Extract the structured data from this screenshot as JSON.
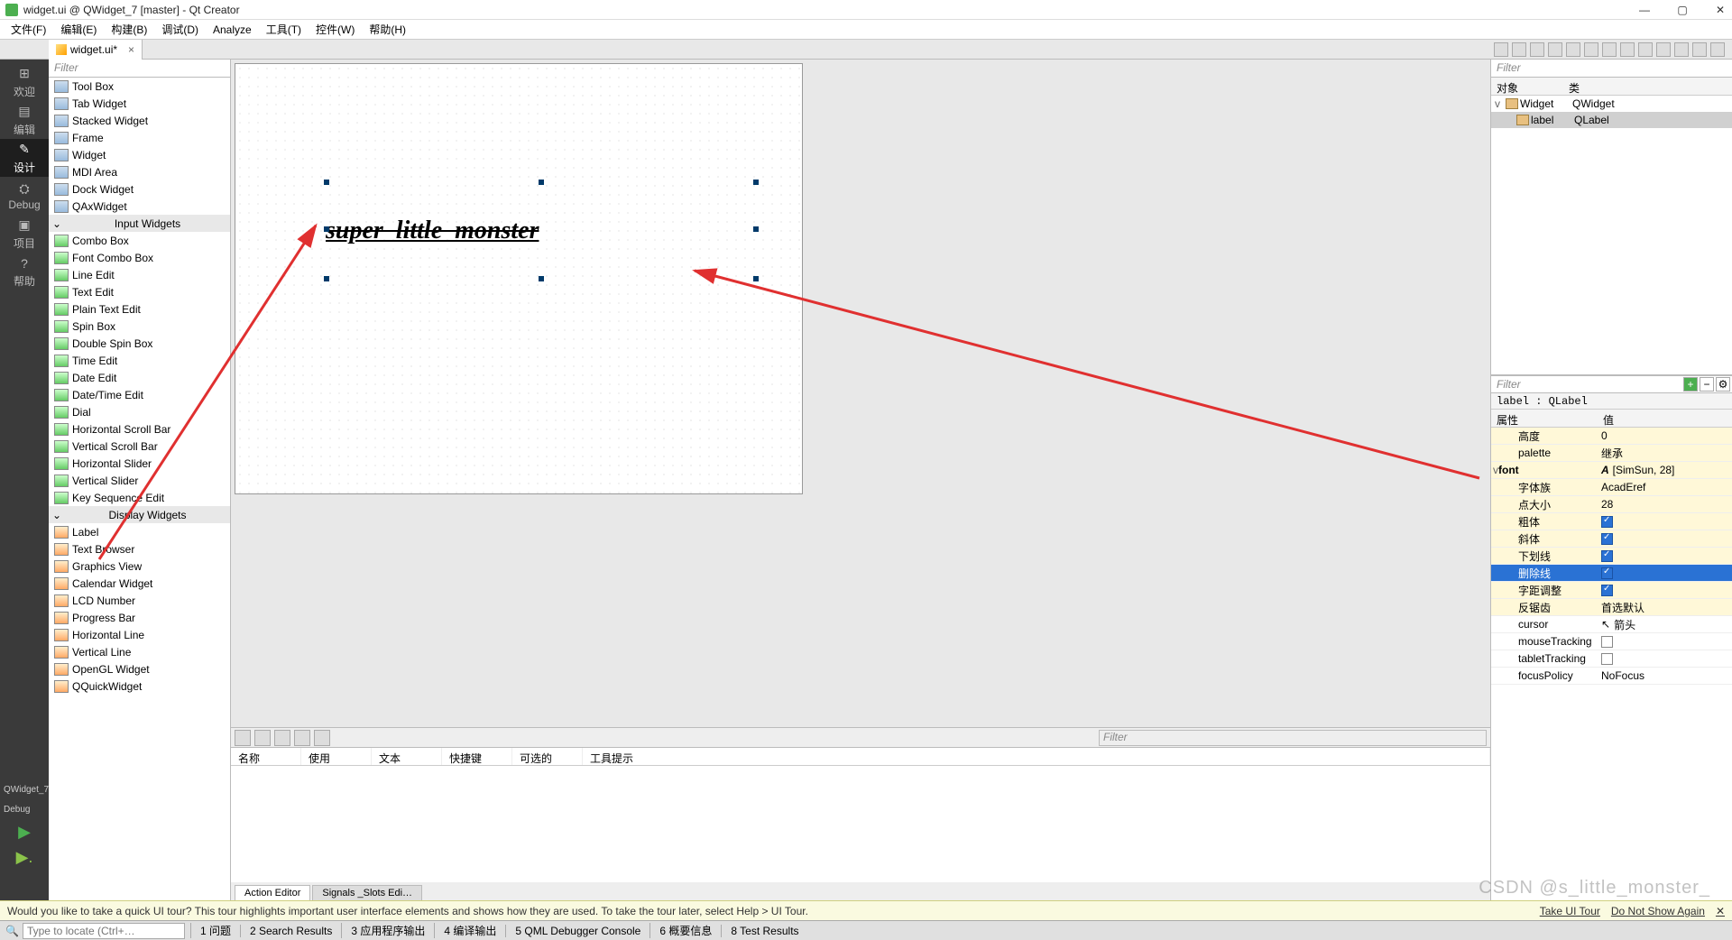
{
  "window": {
    "title": "widget.ui @ QWidget_7 [master] - Qt Creator",
    "min": "—",
    "max": "▢",
    "close": "✕"
  },
  "menu": [
    "文件(F)",
    "编辑(E)",
    "构建(B)",
    "调试(D)",
    "Analyze",
    "工具(T)",
    "控件(W)",
    "帮助(H)"
  ],
  "tab": {
    "filename": "widget.ui*",
    "close": "×"
  },
  "sidebar": [
    {
      "icon": "⊞",
      "label": "欢迎"
    },
    {
      "icon": "▤",
      "label": "编辑"
    },
    {
      "icon": "✎",
      "label": "设计",
      "active": true
    },
    {
      "icon": "⛭",
      "label": "Debug"
    },
    {
      "icon": "▣",
      "label": "项目"
    },
    {
      "icon": "?",
      "label": "帮助"
    }
  ],
  "sidebar_bottom": {
    "project": "QWidget_7",
    "config": "Debug",
    "run": "▶",
    "runsel": "▶."
  },
  "widget_filter": "Filter",
  "widget_groups": {
    "items1": [
      {
        "label": "Tool Box"
      },
      {
        "label": "Tab Widget"
      },
      {
        "label": "Stacked Widget"
      },
      {
        "label": "Frame"
      },
      {
        "label": "Widget"
      },
      {
        "label": "MDI Area"
      },
      {
        "label": "Dock Widget"
      },
      {
        "label": "QAxWidget"
      }
    ],
    "group2": "Input Widgets",
    "items2": [
      {
        "label": "Combo Box"
      },
      {
        "label": "Font Combo Box"
      },
      {
        "label": "Line Edit"
      },
      {
        "label": "Text Edit"
      },
      {
        "label": "Plain Text Edit"
      },
      {
        "label": "Spin Box"
      },
      {
        "label": "Double Spin Box"
      },
      {
        "label": "Time Edit"
      },
      {
        "label": "Date Edit"
      },
      {
        "label": "Date/Time Edit"
      },
      {
        "label": "Dial"
      },
      {
        "label": "Horizontal Scroll Bar"
      },
      {
        "label": "Vertical Scroll Bar"
      },
      {
        "label": "Horizontal Slider"
      },
      {
        "label": "Vertical Slider"
      },
      {
        "label": "Key Sequence Edit"
      }
    ],
    "group3": "Display Widgets",
    "items3": [
      {
        "label": "Label"
      },
      {
        "label": "Text Browser"
      },
      {
        "label": "Graphics View"
      },
      {
        "label": "Calendar Widget"
      },
      {
        "label": "LCD Number"
      },
      {
        "label": "Progress Bar"
      },
      {
        "label": "Horizontal Line"
      },
      {
        "label": "Vertical Line"
      },
      {
        "label": "OpenGL Widget"
      },
      {
        "label": "QQuickWidget"
      }
    ]
  },
  "canvas": {
    "label_text": "super_little_monster"
  },
  "action": {
    "filter": "Filter",
    "headers": [
      "名称",
      "使用",
      "文本",
      "快捷键",
      "可选的",
      "工具提示"
    ],
    "tabs": [
      "Action Editor",
      "Signals _Slots Edi…"
    ]
  },
  "obj": {
    "filter": "Filter",
    "hdr": [
      "对象",
      "类"
    ],
    "rows": [
      {
        "name": "Widget",
        "cls": "QWidget",
        "exp": "v"
      },
      {
        "name": "label",
        "cls": "QLabel",
        "sel": true
      }
    ]
  },
  "propfilter": "Filter",
  "propclass": "label : QLabel",
  "prophdr": [
    "属性",
    "值"
  ],
  "props": [
    {
      "name": "高度",
      "val": "0",
      "yellow": true,
      "indent": 1
    },
    {
      "name": "palette",
      "val": "继承",
      "yellow": true,
      "indent": 1
    },
    {
      "name": "font",
      "val": "[SimSun, 28]",
      "yellow": true,
      "indent": 0,
      "exp": "v",
      "ficon": true
    },
    {
      "name": "字体族",
      "val": "AcadEref",
      "yellow": true,
      "indent": 1
    },
    {
      "name": "点大小",
      "val": "28",
      "yellow": true,
      "indent": 1
    },
    {
      "name": "粗体",
      "chk": true,
      "yellow": true,
      "indent": 1
    },
    {
      "name": "斜体",
      "chk": true,
      "yellow": true,
      "indent": 1
    },
    {
      "name": "下划线",
      "chk": true,
      "yellow": true,
      "indent": 1
    },
    {
      "name": "删除线",
      "chk": true,
      "yellow": true,
      "indent": 1,
      "sel": true
    },
    {
      "name": "字距调整",
      "chk": true,
      "yellow": true,
      "indent": 1
    },
    {
      "name": "反锯齿",
      "val": "首选默认",
      "yellow": true,
      "indent": 1
    },
    {
      "name": "cursor",
      "val": "箭头",
      "indent": 1,
      "cicon": true
    },
    {
      "name": "mouseTracking",
      "chk": false,
      "indent": 1
    },
    {
      "name": "tabletTracking",
      "chk": false,
      "indent": 1
    },
    {
      "name": "focusPolicy",
      "val": "NoFocus",
      "indent": 1
    }
  ],
  "tour": {
    "msg": "Would you like to take a quick UI tour? This tour highlights important user interface elements and shows how they are used. To take the tour later, select Help > UI Tour.",
    "b1": "Take UI Tour",
    "b2": "Do Not Show Again",
    "x": "✕"
  },
  "status": {
    "locate": "Type to locate (Ctrl+…",
    "items": [
      "1 问题",
      "2 Search Results",
      "3 应用程序输出",
      "4 编译输出",
      "5 QML Debugger Console",
      "6 概要信息",
      "8 Test Results"
    ]
  },
  "watermark": "CSDN @s_little_monster_"
}
